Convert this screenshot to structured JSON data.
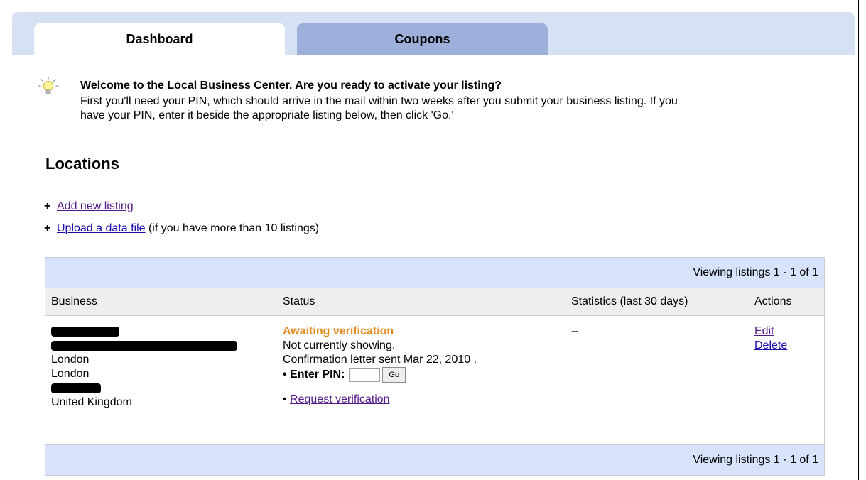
{
  "top_caption": "",
  "tabs": [
    {
      "label": "Dashboard",
      "active": true
    },
    {
      "label": "Coupons",
      "active": false
    }
  ],
  "welcome": {
    "icon": "lightbulb-icon",
    "title": "Welcome to the Local Business Center. Are you ready to activate your listing?",
    "body": "First you'll need your PIN, which should arrive in the mail within two weeks after you submit your business listing. If you have your PIN, enter it beside the appropriate listing below, then click 'Go.'"
  },
  "locations": {
    "title": "Locations",
    "add_listing": {
      "label": "Add new listing"
    },
    "upload": {
      "label": "Upload a data file",
      "suffix": " (if you have more than 10 listings)"
    }
  },
  "table": {
    "viewing_top": "Viewing listings 1 - 1 of 1",
    "viewing_bottom": "Viewing listings 1 - 1 of 1",
    "columns": [
      "Business",
      "Status",
      "Statistics (last 30 days)",
      "Actions"
    ],
    "row": {
      "business": {
        "city": "London",
        "region": "London",
        "country": "United Kingdom"
      },
      "status": {
        "state": "Awaiting verification",
        "showing": "Not currently showing.",
        "letter": "Confirmation letter sent Mar 22, 2010 .",
        "pin_label": "• Enter PIN:",
        "pin_value": "",
        "go_label": "Go",
        "request_prefix": "• ",
        "request_label": "Request verification"
      },
      "statistics": "--",
      "actions": {
        "edit": "Edit",
        "delete": "Delete"
      }
    }
  },
  "colors": {
    "tab_active": "#ffffff",
    "tab_inactive": "#9db0dc",
    "tab_strip": "#d7e1f4",
    "banner": "#d6e3fb",
    "status_awaiting": "#e08a1e",
    "link": "#1a0dab",
    "link_visited": "#551a8b"
  }
}
